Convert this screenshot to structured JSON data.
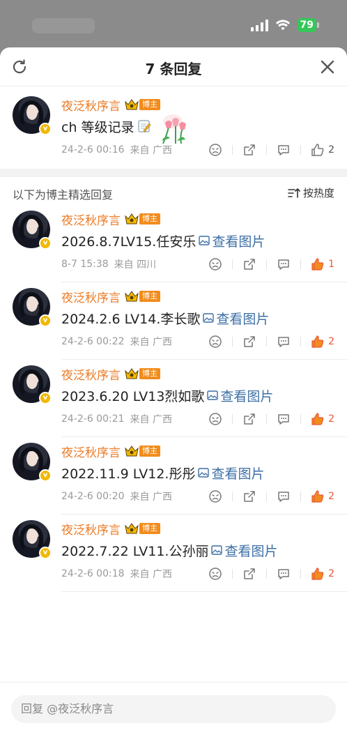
{
  "status_bar": {
    "battery": "79"
  },
  "header": {
    "title": "7 条回复"
  },
  "main_comment": {
    "name": "夜泛秋序言",
    "tag": "博主",
    "content": "ch 等级记录",
    "time": "24-2-6 00:16",
    "location": "来自 广西",
    "likes": "2"
  },
  "section": {
    "label": "以下为博主精选回复",
    "sort_label": "按热度"
  },
  "replies": [
    {
      "name": "夜泛秋序言",
      "tag": "博主",
      "content": "2026.8.7LV15.任安乐",
      "link": "查看图片",
      "time": "8-7 15:38",
      "location": "来自 四川",
      "likes": "1"
    },
    {
      "name": "夜泛秋序言",
      "tag": "博主",
      "content": "2024.2.6 LV14.李长歌",
      "link": "查看图片",
      "time": "24-2-6 00:22",
      "location": "来自 广西",
      "likes": "2"
    },
    {
      "name": "夜泛秋序言",
      "tag": "博主",
      "content": "2023.6.20 LV13烈如歌",
      "link": "查看图片",
      "time": "24-2-6 00:21",
      "location": "来自 广西",
      "likes": "2"
    },
    {
      "name": "夜泛秋序言",
      "tag": "博主",
      "content": "2022.11.9 LV12.彤彤",
      "link": "查看图片",
      "time": "24-2-6 00:20",
      "location": "来自 广西",
      "likes": "2"
    },
    {
      "name": "夜泛秋序言",
      "tag": "博主",
      "content": "2022.7.22 LV11.公孙丽",
      "link": "查看图片",
      "time": "24-2-6 00:18",
      "location": "来自 广西",
      "likes": "2"
    }
  ],
  "reply_input": {
    "placeholder": "回复 @夜泛秋序言"
  },
  "colors": {
    "name": "#eb7a24",
    "link": "#3d6fa5",
    "like_active": "#e8573a",
    "tag": "#f28c1c"
  }
}
